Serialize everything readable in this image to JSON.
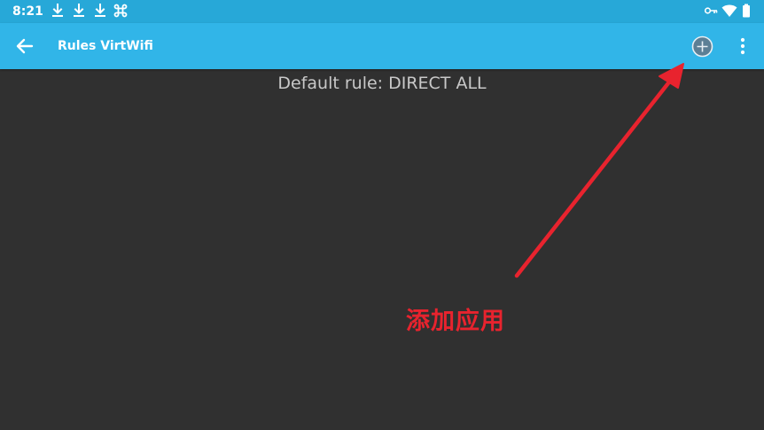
{
  "status_bar": {
    "time": "8:21",
    "notification_icons": [
      "download-icon",
      "download-icon",
      "download-icon",
      "command-icon"
    ],
    "system_icons": [
      "vpn-key-icon",
      "wifi-icon",
      "battery-icon"
    ],
    "background_color": "#27a8d8"
  },
  "app_bar": {
    "title": "Rules VirtWifi",
    "background_color": "#31b5e8",
    "back_icon": "arrow-back-icon",
    "add_icon": "add-circle-icon",
    "menu_icon": "more-vert-icon"
  },
  "content": {
    "default_rule": "Default rule: DIRECT ALL",
    "background_color": "#303030"
  },
  "annotation": {
    "text": "添加应用",
    "color": "#e8232e"
  }
}
